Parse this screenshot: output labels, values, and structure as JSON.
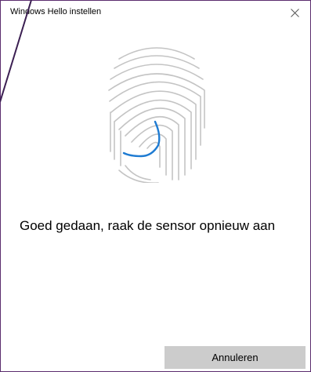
{
  "window": {
    "title": "Windows Hello instellen",
    "close_icon": "close-icon",
    "accent_color": "#1e7bd2",
    "border_color": "#5b2d6e"
  },
  "main": {
    "fingerprint_icon": "fingerprint-icon",
    "message": "Goed gedaan, raak de sensor opnieuw aan"
  },
  "footer": {
    "cancel_label": "Annuleren"
  }
}
